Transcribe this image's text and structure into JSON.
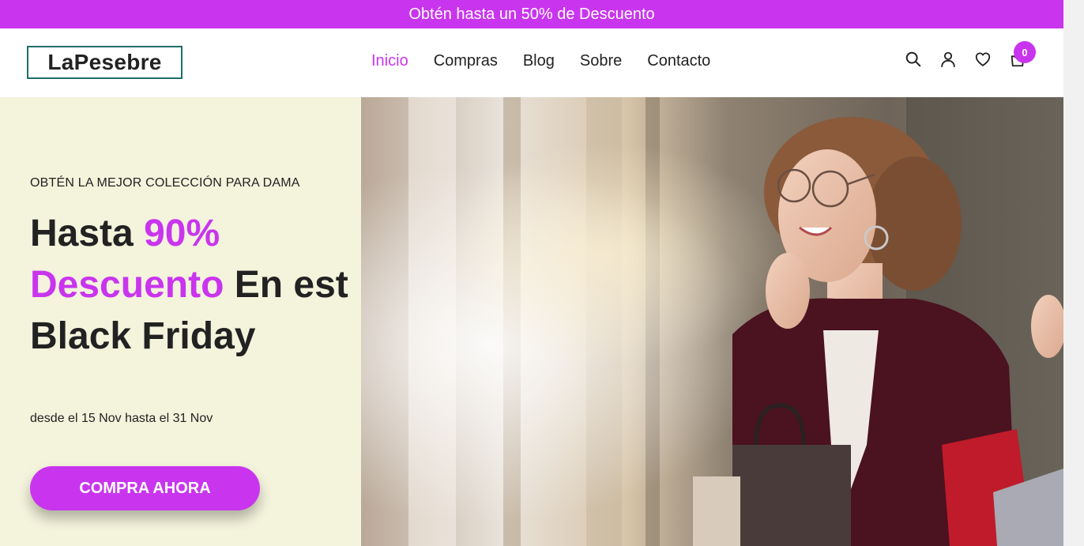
{
  "promo": {
    "text": "Obtén hasta un 50% de Descuento"
  },
  "header": {
    "logo": "LaPesebre",
    "nav": [
      {
        "label": "Inicio",
        "active": true
      },
      {
        "label": "Compras",
        "active": false
      },
      {
        "label": "Blog",
        "active": false
      },
      {
        "label": "Sobre",
        "active": false
      },
      {
        "label": "Contacto",
        "active": false
      }
    ],
    "icons": [
      "search-icon",
      "user-icon",
      "heart-icon",
      "bag-icon"
    ],
    "cart_count": "0"
  },
  "hero": {
    "eyebrow": "OBTÉN LA MEJOR COLECCIÓN PARA DAMA",
    "headline": {
      "part1": "Hasta ",
      "accent1": "90%",
      "accent2": "Descuento",
      "part2": " En est",
      "part3": "Black Friday"
    },
    "dates": "desde el 15 Nov hasta el 31 Nov",
    "cta_label": "COMPRA AHORA"
  },
  "colors": {
    "accent": "#c935ee",
    "hero_bg": "#f4f3dc",
    "logo_border": "#1f6f6a",
    "text": "#222222"
  }
}
